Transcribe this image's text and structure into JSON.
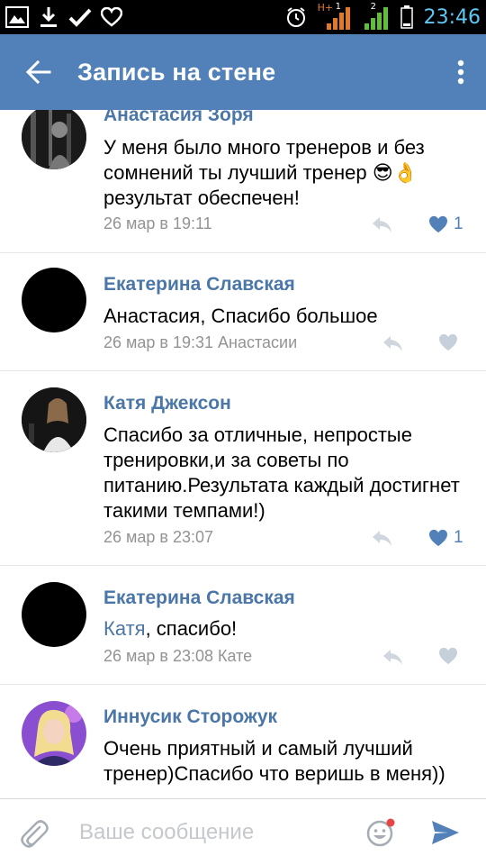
{
  "statusbar": {
    "time": "23:46",
    "network_label": "H+",
    "sim1": "1",
    "sim2": "2"
  },
  "appbar": {
    "title": "Запись на стене",
    "color": "#5181b8"
  },
  "comments": [
    {
      "author": "Анастасия Зоря",
      "text": "У меня было много тренеров и без сомнений ты лучший тренер 😎👌результат обеспечен!",
      "date": "26 мар в 19:11",
      "likes": "1",
      "liked": true
    },
    {
      "author": "Екатерина Славская",
      "text": "Анастасия, Спасибо большое",
      "date": "26 мар в 19:31 Анастасии",
      "likes": "",
      "liked": false
    },
    {
      "author": "Катя Джексон",
      "text": "Спасибо за отличные, непростые тренировки,и за советы по питанию.Результата каждый достигнет такими темпами!)",
      "date": "26 мар в 23:07",
      "likes": "1",
      "liked": true
    },
    {
      "author": "Екатерина Славская",
      "mention": "Катя",
      "text": ", спасибо!",
      "date": "26 мар в 23:08 Кате",
      "likes": "",
      "liked": false
    },
    {
      "author": "Иннусик Сторожук",
      "text": "Очень приятный и самый лучший тренер)Спасибо что веришь в меня))",
      "date": "",
      "likes": "",
      "liked": false
    }
  ],
  "composer": {
    "placeholder": "Ваше сообщение",
    "value": ""
  },
  "icons": {
    "back": "arrow-left-icon",
    "more": "more-vertical-icon",
    "reply": "reply-icon",
    "like": "heart-icon",
    "attach": "paperclip-icon",
    "emoji": "smile-icon",
    "send": "send-icon"
  },
  "colors": {
    "accent": "#5181b8",
    "author": "#4a76a8",
    "meta": "#939393",
    "liked_heart": "#5181b8",
    "unliked_heart": "#c5d0db",
    "emoji_badge": "#e64646"
  }
}
